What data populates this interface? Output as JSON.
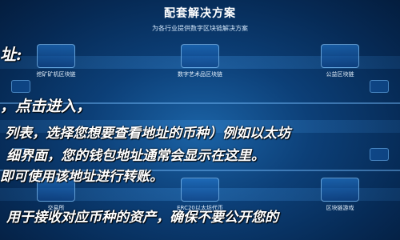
{
  "header": {
    "title": "配套解决方案",
    "subtitle": "为各行业提供数字区块链解决方案"
  },
  "tiles": [
    {
      "label": "挖矿矿机区块链"
    },
    {
      "label": "数字艺术品区块链"
    },
    {
      "label": "公益区块链"
    },
    {
      "label": "交易所"
    },
    {
      "label": "ERC20以太坊代币"
    },
    {
      "label": "区块链游戏"
    }
  ],
  "overlay": {
    "line1": "址:",
    "line2": "，点击进入，",
    "line3": "列表，选择您想要查看地址的币种）例如以太坊",
    "line4": "细界面，您的钱包地址通常会显示在这里。",
    "line5": "即可使用该地址进行转账。",
    "line6": "用于接收对应币种的资产，确保不要公开您的"
  }
}
